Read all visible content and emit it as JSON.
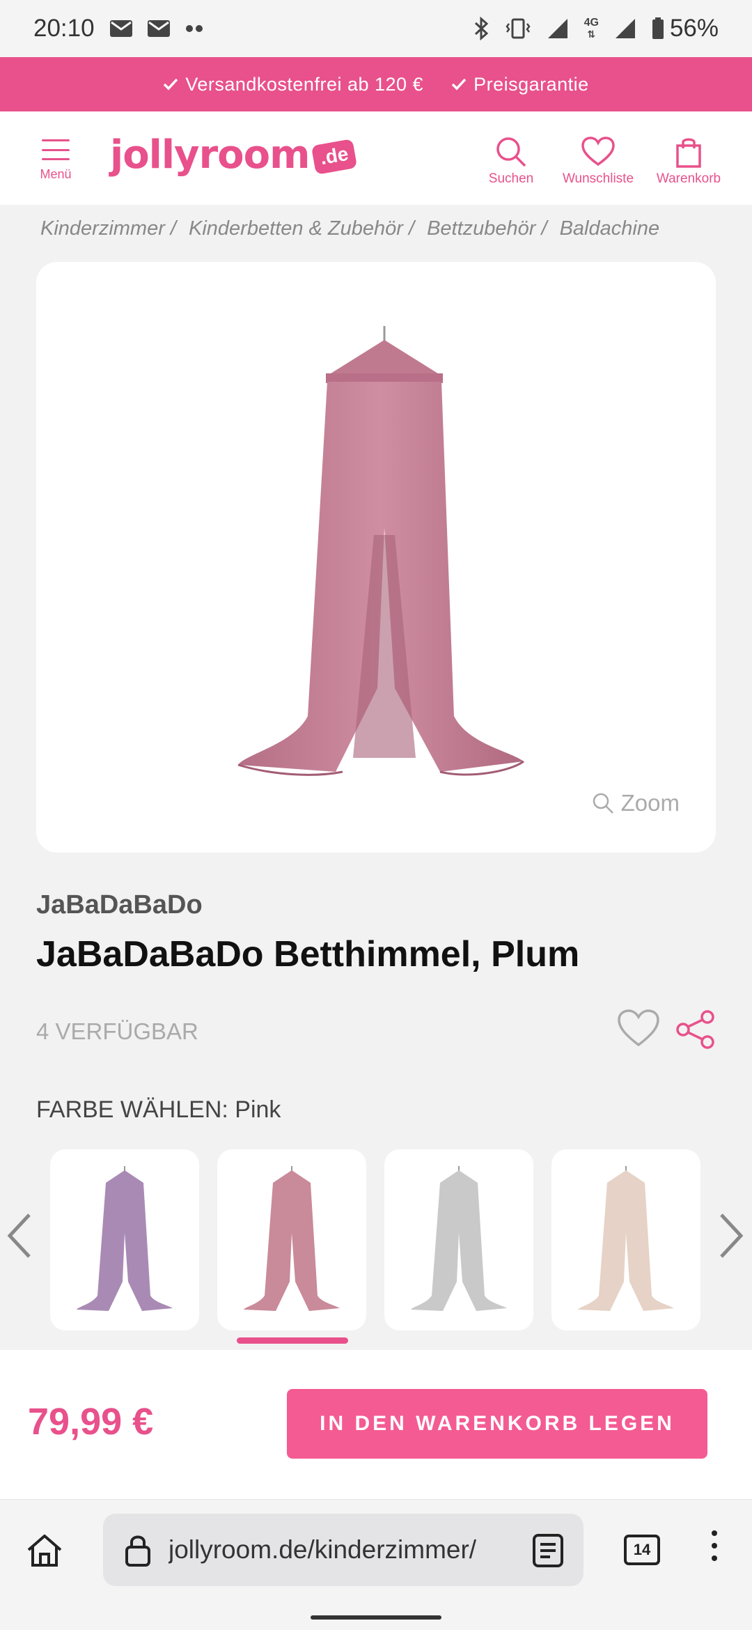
{
  "status_bar": {
    "time": "20:10",
    "network": "4G",
    "battery": "56%"
  },
  "promo": {
    "item1": "Versandkostenfrei ab 120 €",
    "item2": "Preisgarantie"
  },
  "header": {
    "menu_label": "Menü",
    "logo_text": "jollyroom",
    "logo_badge": ".de",
    "search_label": "Suchen",
    "wishlist_label": "Wunschliste",
    "cart_label": "Warenkorb"
  },
  "breadcrumb": [
    "Kinderzimmer",
    "Kinderbetten & Zubehör",
    "Bettzubehör",
    "Baldachine"
  ],
  "product": {
    "zoom_label": "Zoom",
    "brand": "JaBaDaBaDo",
    "title": "JaBaDaBaDo Betthimmel, Plum",
    "availability": "4 VERFÜGBAR",
    "color_label": "FARBE WÄHLEN: Pink",
    "variants": [
      {
        "color": "#a98ab5"
      },
      {
        "color": "#c98a9a"
      },
      {
        "color": "#c9c9c9"
      },
      {
        "color": "#e6d2c6"
      }
    ],
    "selected_variant": 1
  },
  "purchase": {
    "price": "79,99 €",
    "cart_button": "IN DEN WARENKORB LEGEN"
  },
  "browser": {
    "url": "jollyroom.de/kinderzimmer/",
    "tab_count": "14"
  },
  "colors": {
    "brand_pink": "#e8518b",
    "button_pink": "#f45b93"
  }
}
